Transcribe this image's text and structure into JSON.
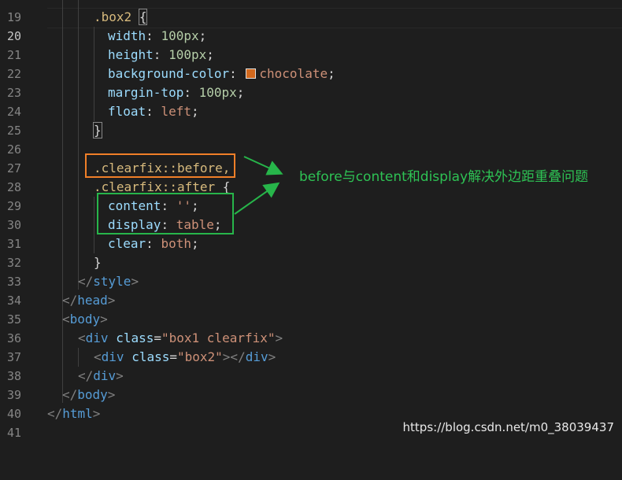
{
  "lines": [
    {
      "num": "19"
    },
    {
      "num": "20",
      "selector": ".box2",
      "brace": "{"
    },
    {
      "num": "21",
      "prop": "width",
      "value": "100px"
    },
    {
      "num": "22",
      "prop": "height",
      "value": "100px"
    },
    {
      "num": "23",
      "prop": "background-color",
      "value": "chocolate"
    },
    {
      "num": "24",
      "prop": "margin-top",
      "value": "100px"
    },
    {
      "num": "25",
      "prop": "float",
      "value": "left"
    },
    {
      "num": "26",
      "brace": "}"
    },
    {
      "num": "27"
    },
    {
      "num": "28",
      "selector": ".clearfix::before,"
    },
    {
      "num": "29",
      "selector": ".clearfix::after",
      "brace": "{"
    },
    {
      "num": "30",
      "prop": "content",
      "value": "''"
    },
    {
      "num": "31",
      "prop": "display",
      "value": "table"
    },
    {
      "num": "32",
      "prop": "clear",
      "value": "both"
    },
    {
      "num": "33",
      "brace": "}"
    },
    {
      "num": "34",
      "tag_close": "style"
    },
    {
      "num": "35",
      "tag_close": "head"
    },
    {
      "num": "36",
      "tag_open": "body"
    },
    {
      "num": "37",
      "tag_open": "div",
      "attr": "class",
      "attr_value": "\"box1 clearfix\""
    },
    {
      "num": "38",
      "tag_open": "div",
      "attr": "class",
      "attr_value": "\"box2\"",
      "tag_close": "div"
    },
    {
      "num": "39",
      "tag_close": "div"
    },
    {
      "num": "40",
      "tag_close": "body"
    },
    {
      "num": "41",
      "tag_close": "html"
    }
  ],
  "annotation": "before与content和display解决外边距重叠问题",
  "watermark": "https://blog.csdn.net/m0_38039437",
  "colors": {
    "background": "#1e1e1e",
    "selector": "#d7ba7d",
    "property": "#9cdcfe",
    "number": "#b5cea8",
    "string": "#ce9178",
    "tag": "#569cd6",
    "swatch_chocolate": "#d2691e",
    "orange_box": "#f07f28",
    "green_box": "#27b54a"
  },
  "icons": {
    "color_swatch": "chocolate-swatch-icon"
  }
}
